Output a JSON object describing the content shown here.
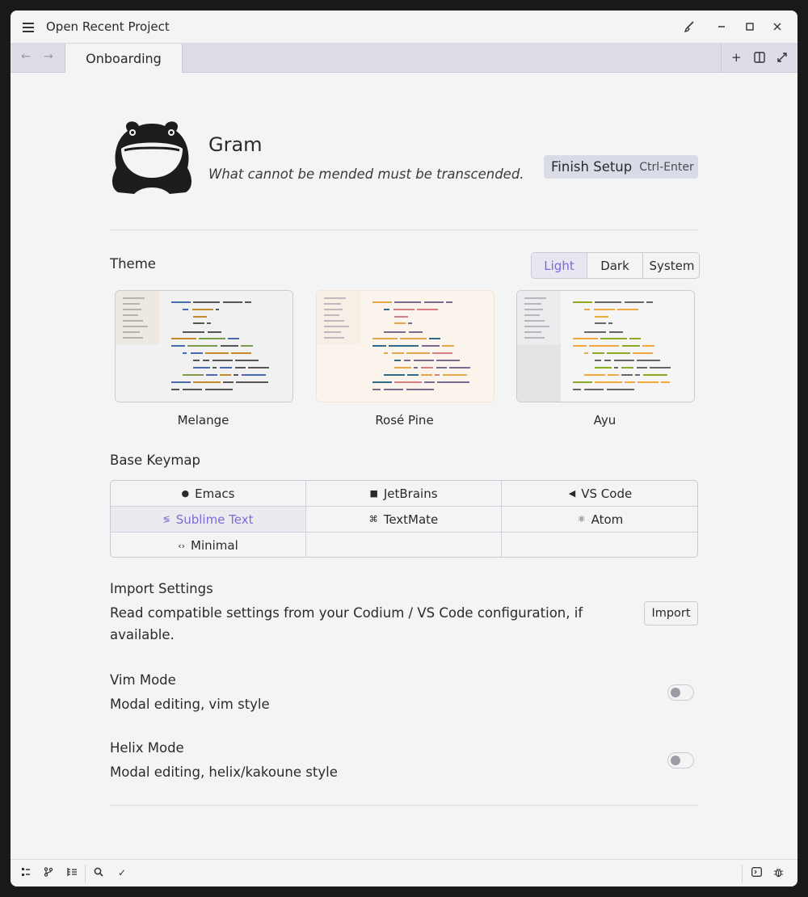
{
  "window": {
    "title": "Open Recent Project"
  },
  "titlebar_icons": [
    "menu-icon",
    "paint-brush-icon",
    "minimize-icon",
    "maximize-icon",
    "close-icon"
  ],
  "tabs": [
    {
      "label": "Onboarding",
      "active": true
    }
  ],
  "header": {
    "app_name": "Gram",
    "tagline": "What cannot be mended must be transcended.",
    "finish_label": "Finish Setup",
    "finish_shortcut": "Ctrl-Enter"
  },
  "theme": {
    "heading": "Theme",
    "modes": [
      "Light",
      "Dark",
      "System"
    ],
    "selected_mode": "Light",
    "options": [
      {
        "name": "Melange",
        "bg": "#f1f1f1",
        "gutter": "#ede8e2"
      },
      {
        "name": "Rosé Pine",
        "bg": "#faf4ed",
        "gutter": "#f7efe6"
      },
      {
        "name": "Ayu",
        "bg": "#f5f5f6",
        "gutter": "#e4e4e6"
      }
    ]
  },
  "keymap": {
    "heading": "Base Keymap",
    "options": [
      {
        "label": "Emacs",
        "icon": "emacs-icon",
        "glyph": "●"
      },
      {
        "label": "JetBrains",
        "icon": "jetbrains-icon",
        "glyph": "■"
      },
      {
        "label": "VS Code",
        "icon": "vscode-icon",
        "glyph": "◀"
      },
      {
        "label": "Sublime Text",
        "icon": "sublime-icon",
        "glyph": "≶",
        "selected": true
      },
      {
        "label": "TextMate",
        "icon": "textmate-icon",
        "glyph": "⌘"
      },
      {
        "label": "Atom",
        "icon": "atom-icon",
        "glyph": "⚛"
      },
      {
        "label": "Minimal",
        "icon": "code-icon",
        "glyph": "‹›"
      }
    ]
  },
  "import": {
    "heading": "Import Settings",
    "description_line1": "Read compatible settings from your Codium / VS Code configuration, if",
    "description_line2": "available.",
    "button": "Import"
  },
  "vim": {
    "heading": "Vim Mode",
    "description": "Modal editing, vim style",
    "enabled": false
  },
  "helix": {
    "heading": "Helix Mode",
    "description": "Modal editing, helix/kakoune style",
    "enabled": false
  },
  "colors": {
    "accent": "#7b6ad6",
    "tabbar": "#dcdde6",
    "background": "#f4f4f5"
  }
}
